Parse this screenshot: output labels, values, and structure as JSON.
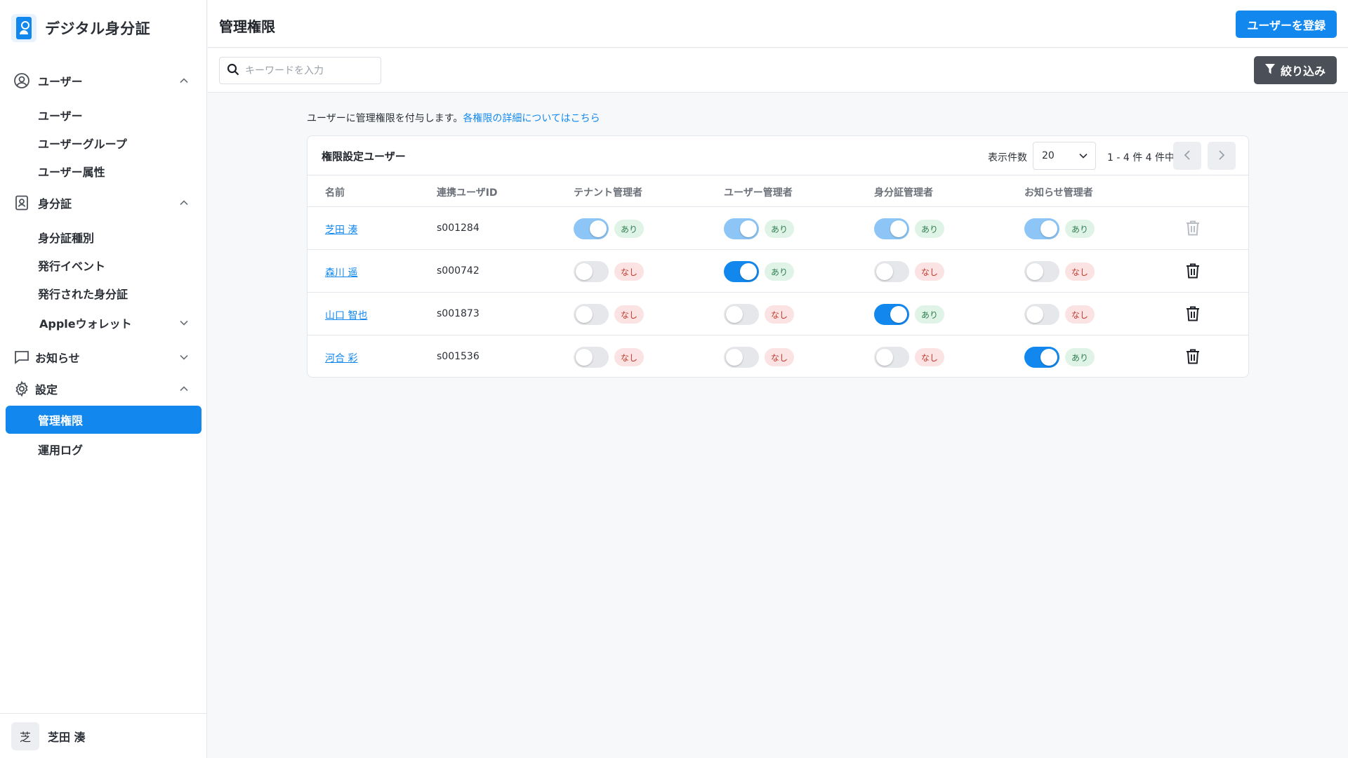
{
  "sidebar": {
    "brand": "デジタル身分証",
    "sections": {
      "users": {
        "label": "ユーザー",
        "items": [
          "ユーザー",
          "ユーザーグループ",
          "ユーザー属性"
        ]
      },
      "id": {
        "label": "身分証",
        "items": [
          "身分証種別",
          "発行イベント",
          "発行された身分証"
        ],
        "sub": "Appleウォレット"
      },
      "notice": {
        "label": "お知らせ"
      },
      "settings": {
        "label": "設定",
        "items": [
          "管理権限",
          "運用ログ"
        ]
      }
    },
    "user": {
      "avatar": "芝",
      "name": "芝田 湊"
    }
  },
  "header": {
    "title": "管理権限",
    "register_label": "ユーザーを登録"
  },
  "toolbar": {
    "search_placeholder": "キーワードを入力",
    "filter_label": "絞り込み"
  },
  "description": {
    "text": "ユーザーに管理権限を付与します。",
    "link": "各権限の詳細についてはこちら"
  },
  "card": {
    "title": "権限設定ユーザー",
    "per_page_label": "表示件数",
    "per_page": "20",
    "range": "1 - 4 件 4 件中",
    "columns": [
      "名前",
      "連携ユーザID",
      "テナント管理者",
      "ユーザー管理者",
      "身分証管理者",
      "お知らせ管理者"
    ],
    "rows": [
      {
        "name": "芝田 湊",
        "id": "s001284",
        "perms": [
          true,
          true,
          true,
          true
        ],
        "labels": [
          "あり",
          "あり",
          "あり",
          "あり"
        ],
        "self": true
      },
      {
        "name": "森川 遥",
        "id": "s000742",
        "perms": [
          false,
          true,
          false,
          false
        ],
        "labels": [
          "なし",
          "あり",
          "なし",
          "なし"
        ],
        "self": false
      },
      {
        "name": "山口 智也",
        "id": "s001873",
        "perms": [
          false,
          false,
          true,
          false
        ],
        "labels": [
          "なし",
          "なし",
          "あり",
          "なし"
        ],
        "self": false
      },
      {
        "name": "河合 彩",
        "id": "s001536",
        "perms": [
          false,
          false,
          false,
          true
        ],
        "labels": [
          "なし",
          "なし",
          "なし",
          "あり"
        ],
        "self": false
      }
    ]
  },
  "colors": {
    "primary": "#1288ef",
    "muted_toggle": "#8cc5f6",
    "yes_bg": "#dff3e7",
    "no_bg": "#fbe3e3"
  }
}
